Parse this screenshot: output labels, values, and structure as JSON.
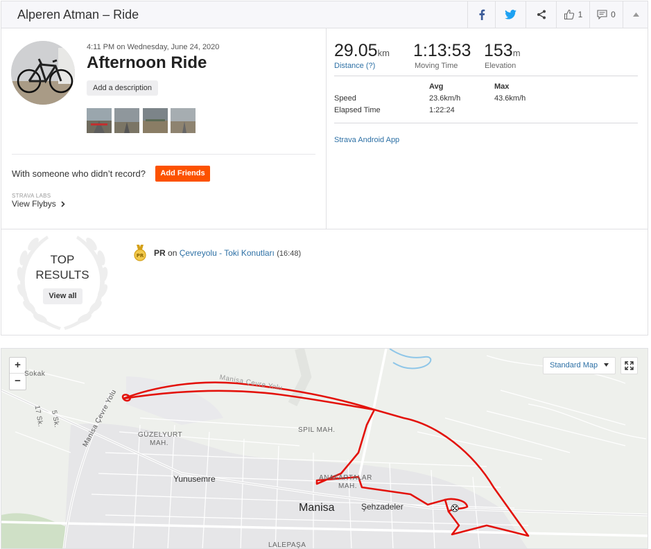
{
  "header": {
    "title": "Alperen Atman – Ride",
    "kudos_count": "1",
    "comment_count": "0"
  },
  "activity": {
    "datetime": "4:11 PM on Wednesday, June 24, 2020",
    "name": "Afternoon Ride",
    "add_description": "Add a description",
    "with_someone": "With someone who didn’t record?",
    "add_friends": "Add Friends",
    "labs_label": "STRAVA LABS",
    "view_flybys": "View Flybys"
  },
  "stats": {
    "distance": {
      "value": "29.05",
      "unit": "km",
      "label": "Distance (?)"
    },
    "moving_time": {
      "value": "1:13:53",
      "label": "Moving Time"
    },
    "elevation": {
      "value": "153",
      "unit": "m",
      "label": "Elevation"
    },
    "table": {
      "headers": [
        "Avg",
        "Max"
      ],
      "rows": [
        {
          "label": "Speed",
          "avg": "23.6km/h",
          "max": "43.6km/h"
        },
        {
          "label": "Elapsed Time",
          "avg": "1:22:24",
          "max": ""
        }
      ]
    },
    "device": "Strava Android App"
  },
  "results": {
    "top_line1": "TOP",
    "top_line2": "RESULTS",
    "view_all": "View all",
    "pr_label": "PR",
    "pr_on": "on",
    "segment": "Çevreyolu - Toki Konutları",
    "segment_time": "(16:48)"
  },
  "map": {
    "map_type": "Standard Map",
    "zoom_in": "+",
    "zoom_out": "−",
    "route_color": "#e3120b",
    "places": {
      "guzelyurt1": "GÜZELYURT",
      "guzelyurt2": "MAH.",
      "yunusemre": "Yunusemre",
      "spil": "SPIL MAH.",
      "anafartalar1": "ANAFARTALAR",
      "anafartalar2": "MAH.",
      "manisa": "Manisa",
      "sehzadeler": "Şehzadeler",
      "lalepasa": "LALEPAŞA",
      "cevre_yolu": "Manisa Çevre Yolu",
      "cevre_yolu2": "Manisa Çevre Yolu",
      "sokak": "Sokak",
      "sk17": "17 Sk.",
      "sk5": "5 Sk."
    }
  }
}
